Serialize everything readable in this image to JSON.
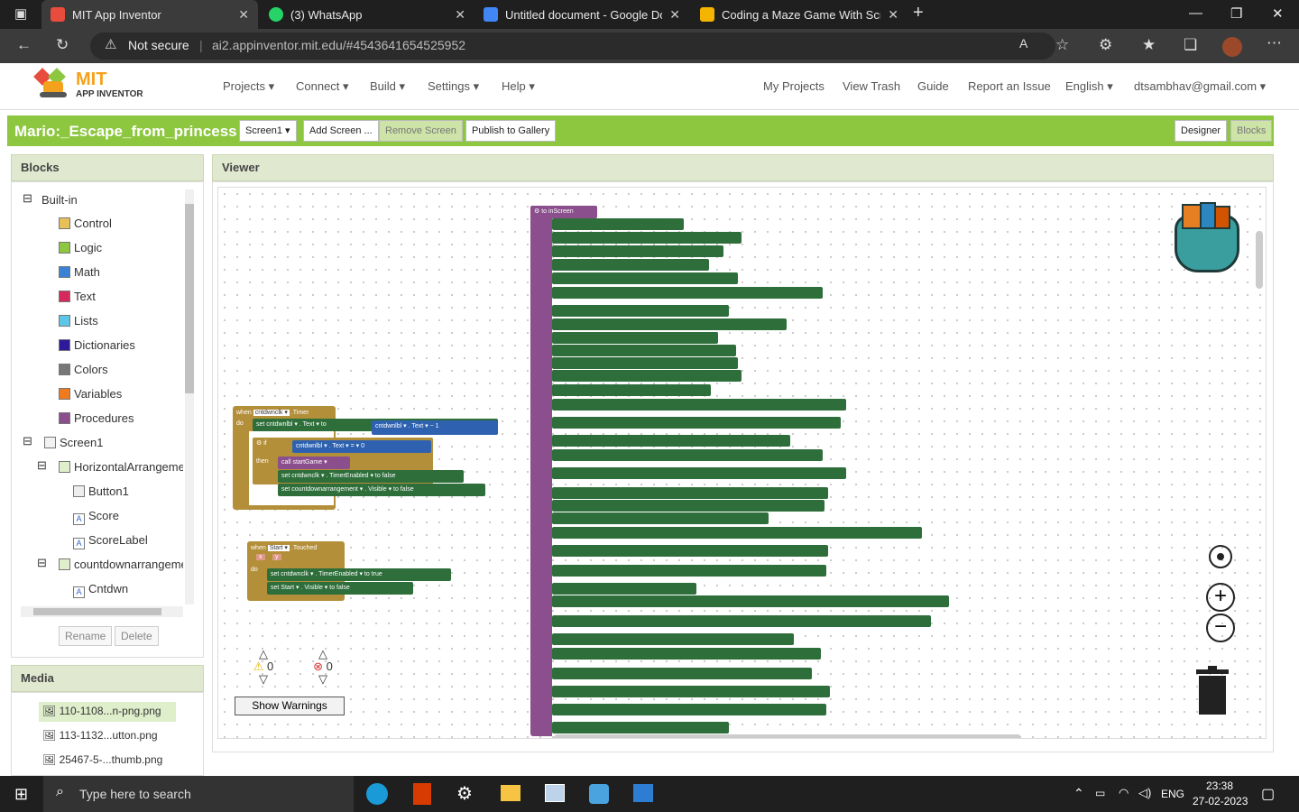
{
  "browser": {
    "tabs": [
      {
        "title": "MIT App Inventor",
        "color": "#e74c3c"
      },
      {
        "title": "(3) WhatsApp",
        "color": "#25d366"
      },
      {
        "title": "Untitled document - Google Doc",
        "color": "#4285f4"
      },
      {
        "title": "Coding a Maze Game With Scratc",
        "color": "#f4b400"
      }
    ],
    "security": "Not secure",
    "url": "ai2.appinventor.mit.edu/#4543641654525952"
  },
  "app": {
    "logo_top": "MIT",
    "logo_bottom": "APP INVENTOR",
    "menu": [
      "Projects",
      "Connect",
      "Build",
      "Settings",
      "Help"
    ],
    "right_menu": [
      "My Projects",
      "View Trash",
      "Guide",
      "Report an Issue",
      "English",
      "dtsambhav@gmail.com"
    ],
    "project_title": "Mario:_Escape_from_princess",
    "screen_select": "Screen1",
    "buttons": [
      "Add Screen ...",
      "Remove Screen",
      "Publish to Gallery"
    ],
    "view_buttons": [
      "Designer",
      "Blocks"
    ]
  },
  "blocks_panel": {
    "title": "Blocks",
    "builtin": "Built-in",
    "items": [
      {
        "label": "Control",
        "color": "#e8c05a"
      },
      {
        "label": "Logic",
        "color": "#8dc63f"
      },
      {
        "label": "Math",
        "color": "#3b82d6"
      },
      {
        "label": "Text",
        "color": "#d6285d"
      },
      {
        "label": "Lists",
        "color": "#5cc6e8"
      },
      {
        "label": "Dictionaries",
        "color": "#2d1a9a"
      },
      {
        "label": "Colors",
        "color": "#777777"
      },
      {
        "label": "Variables",
        "color": "#f07a1e"
      },
      {
        "label": "Procedures",
        "color": "#8a4f8c"
      }
    ],
    "components": [
      "Screen1",
      "HorizontalArrangemer",
      "Button1",
      "Score",
      "ScoreLabel",
      "countdownarrangeme",
      "Cntdwn"
    ],
    "rename": "Rename",
    "delete": "Delete"
  },
  "media": {
    "title": "Media",
    "files": [
      "110-1108...n-png.png",
      "113-1132...utton.png",
      "25467-5-...thumb.png"
    ]
  },
  "viewer": {
    "title": "Viewer",
    "warnings": "0",
    "errors": "0",
    "show_warnings": "Show Warnings"
  },
  "taskbar": {
    "search": "Type here to search",
    "lang": "ENG",
    "time": "23:38",
    "date": "27-02-2023"
  }
}
